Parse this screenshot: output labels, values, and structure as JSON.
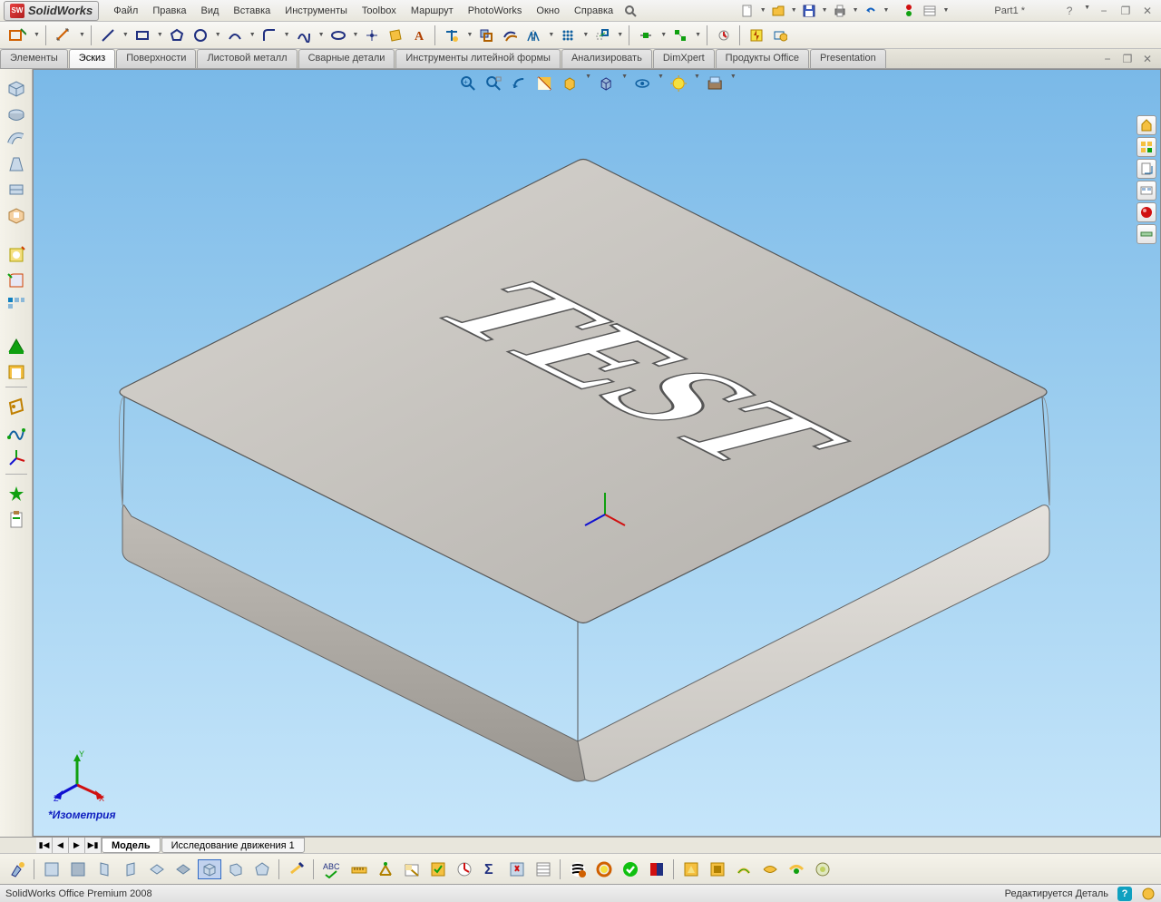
{
  "app": {
    "name": "SolidWorks"
  },
  "menubar": {
    "items": [
      "Файл",
      "Правка",
      "Вид",
      "Вставка",
      "Инструменты",
      "Toolbox",
      "Маршрут",
      "PhotoWorks",
      "Окно",
      "Справка"
    ]
  },
  "document": {
    "title": "Part1 *"
  },
  "window_controls": {
    "help": "?",
    "min": "−",
    "restore": "❐",
    "close": "✕"
  },
  "ribbon": {
    "tabs": [
      "Элементы",
      "Эскиз",
      "Поверхности",
      "Листовой металл",
      "Сварные детали",
      "Инструменты литейной формы",
      "Анализировать",
      "DimXpert",
      "Продукты Office",
      "Presentation"
    ],
    "active": 1
  },
  "viewport": {
    "orientation_label": "*Изометрия",
    "engraved_text": "TEST"
  },
  "bottom_tabs": {
    "tabs": [
      "Модель",
      "Исследование движения 1"
    ],
    "active": 0
  },
  "statusbar": {
    "left": "SolidWorks Office Premium 2008",
    "right": "Редактируется Деталь"
  }
}
